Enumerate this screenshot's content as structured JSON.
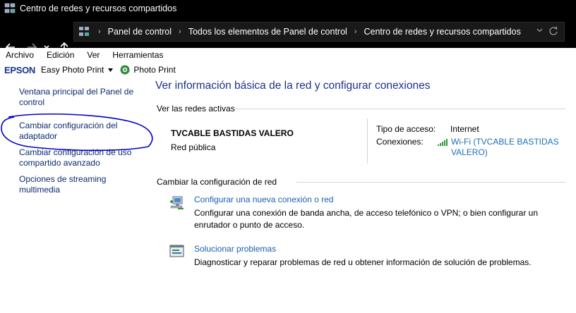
{
  "window": {
    "title": "Centro de redes y recursos compartidos"
  },
  "address_bar": {
    "crumbs": [
      "Panel de control",
      "Todos los elementos de Panel de control",
      "Centro de redes y recursos compartidos"
    ]
  },
  "menu": [
    "Archivo",
    "Edición",
    "Ver",
    "Herramientas"
  ],
  "toolbar": {
    "brand": "EPSON",
    "easy_photo_print": "Easy Photo Print",
    "photo_print": "Photo Print"
  },
  "sidebar": {
    "items": [
      {
        "label": "Ventana principal del Panel de control"
      },
      {
        "label": "Cambiar configuración del adaptador"
      },
      {
        "label": "Cambiar configuración de uso compartido avanzado"
      },
      {
        "label": "Opciones de streaming multimedia"
      }
    ]
  },
  "main": {
    "heading": "Ver información básica de la red y configurar conexiones",
    "active_networks_label": "Ver las redes activas",
    "network": {
      "name": "TVCABLE BASTIDAS VALERO",
      "type": "Red pública",
      "access_type_label": "Tipo de acceso:",
      "access_type_value": "Internet",
      "connections_label": "Conexiones:",
      "connection_link": "Wi-Fi (TVCABLE BASTIDAS VALERO)"
    },
    "change_settings_label": "Cambiar la configuración de red",
    "tasks": [
      {
        "title": "Configurar una nueva conexión o red",
        "description": "Configurar una conexión de banda ancha, de acceso telefónico o VPN; o bien configurar un enrutador o punto de acceso.",
        "icon": "new-connection-icon"
      },
      {
        "title": "Solucionar problemas",
        "description": "Diagnosticar y reparar problemas de red u obtener información de solución de problemas.",
        "icon": "troubleshoot-icon"
      }
    ]
  },
  "colors": {
    "link": "#1c5fb0",
    "heading": "#1e3287",
    "annotation": "#0000cc",
    "titlebar": "#000000"
  }
}
